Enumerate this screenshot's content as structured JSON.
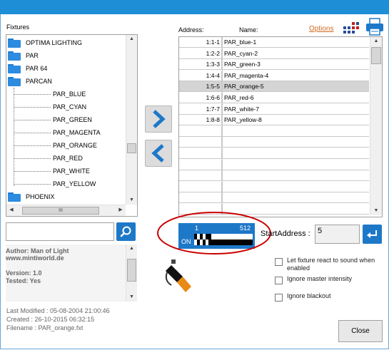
{
  "fixtures": {
    "label": "Fixtures",
    "tree": [
      {
        "label": "OPTIMA LIGHTING",
        "type": "folder"
      },
      {
        "label": "PAR",
        "type": "folder"
      },
      {
        "label": "PAR 64",
        "type": "folder"
      },
      {
        "label": "PARCAN",
        "type": "folder"
      },
      {
        "label": "PAR_BLUE",
        "type": "child"
      },
      {
        "label": "PAR_CYAN",
        "type": "child"
      },
      {
        "label": "PAR_GREEN",
        "type": "child"
      },
      {
        "label": "PAR_MAGENTA",
        "type": "child"
      },
      {
        "label": "PAR_ORANGE",
        "type": "child"
      },
      {
        "label": "PAR_RED",
        "type": "child"
      },
      {
        "label": "PAR_WHITE",
        "type": "child"
      },
      {
        "label": "PAR_YELLOW",
        "type": "child"
      },
      {
        "label": "PHOENIX",
        "type": "folder"
      }
    ],
    "hscroll_grip": "III",
    "search_value": "",
    "info": {
      "author": "Author: Man of Light",
      "website": "www.mintiworld.de",
      "version": "Version: 1.0",
      "tested": "Tested: Yes"
    },
    "meta": {
      "modified": "Last Modified : 05-08-2004 21:00:46",
      "created": "Created : 26-10-2015 06:32:15",
      "filename": "Filename : PAR_orange.fxt"
    }
  },
  "patch": {
    "address_header": "Address:",
    "name_header": "Name:",
    "options_link": "Options",
    "rows": [
      {
        "address": "1:1-1",
        "name": "PAR_blue-1",
        "selected": false
      },
      {
        "address": "1:2-2",
        "name": "PAR_cyan-2",
        "selected": false
      },
      {
        "address": "1:3-3",
        "name": "PAR_green-3",
        "selected": false
      },
      {
        "address": "1:4-4",
        "name": "PAR_magenta-4",
        "selected": false
      },
      {
        "address": "1:5-5",
        "name": "PAR_orange-5",
        "selected": true
      },
      {
        "address": "1:6-6",
        "name": "PAR_red-6",
        "selected": false
      },
      {
        "address": "1:7-7",
        "name": "PAR_white-7",
        "selected": false
      },
      {
        "address": "1:8-8",
        "name": "PAR_yellow-8",
        "selected": false
      }
    ],
    "empty_rows": 8
  },
  "dmx": {
    "start_label": "1",
    "end_label": "512",
    "on_label": "ON",
    "start_address_label": "StartAddress :",
    "start_address_value": "5"
  },
  "options": [
    {
      "label": "Let fixture react to sound when enabled",
      "checked": false
    },
    {
      "label": "Ignore master intensity",
      "checked": false
    },
    {
      "label": "Ignore blackout",
      "checked": false
    }
  ],
  "close_label": "Close",
  "colors": {
    "accent": "#1e8ed6",
    "options_link": "#d2691e",
    "highlight_ring": "#cc0000",
    "dmx_bar": "#1e78c8"
  },
  "icons": [
    "folder-icon",
    "search-icon",
    "chevron-right-icon",
    "chevron-left-icon",
    "enter-icon",
    "grid-icon",
    "printer-icon",
    "spotlight-icon"
  ]
}
